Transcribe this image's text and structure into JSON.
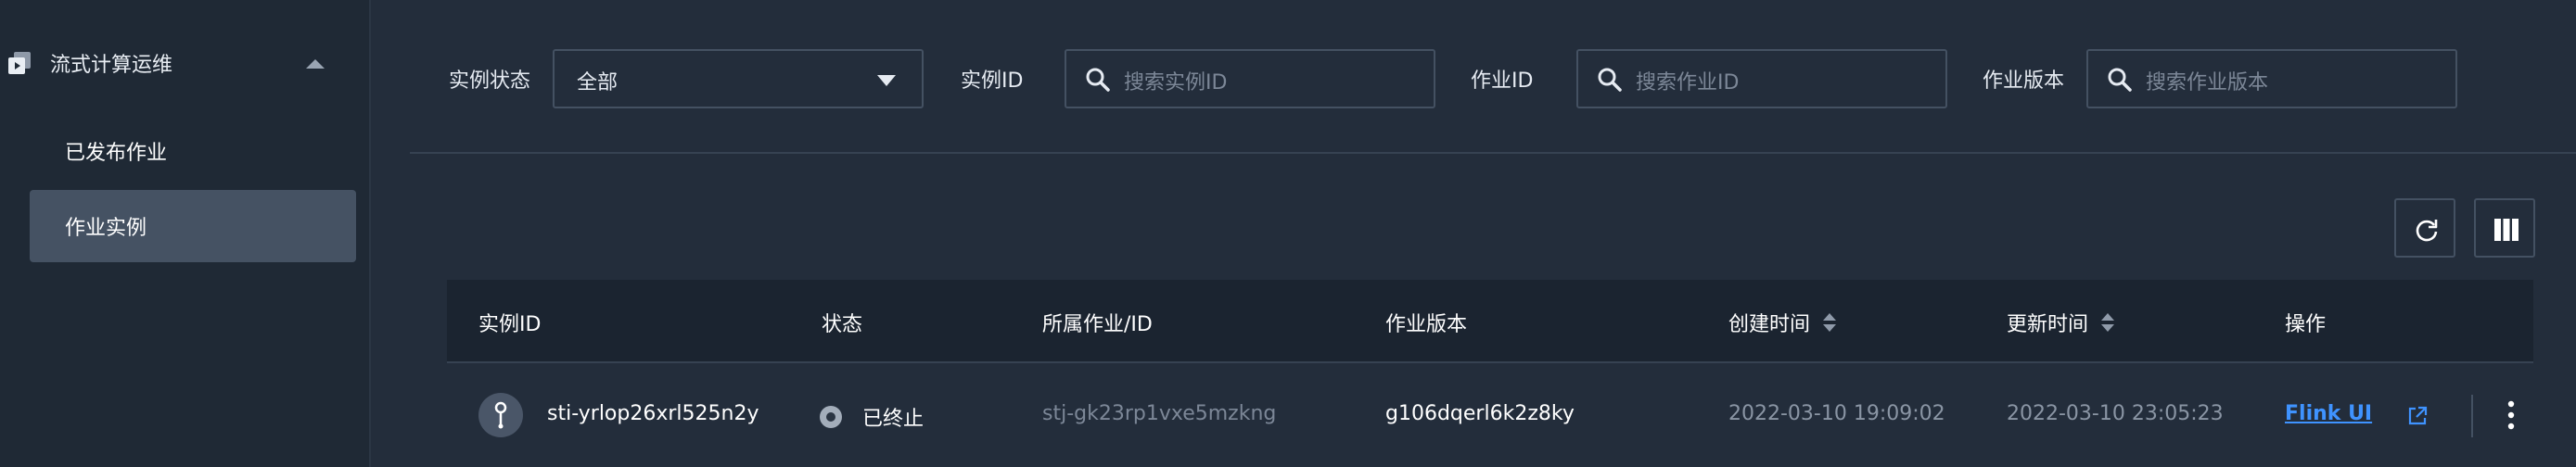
{
  "sidebar": {
    "group_label": "流式计算运维",
    "items": [
      {
        "label": "已发布作业"
      },
      {
        "label": "作业实例"
      }
    ]
  },
  "filters": {
    "status_label": "实例状态",
    "status_value": "全部",
    "instance_id_label": "实例ID",
    "instance_id_placeholder": "搜索实例ID",
    "job_id_label": "作业ID",
    "job_id_placeholder": "搜索作业ID",
    "job_version_label": "作业版本",
    "job_version_placeholder": "搜索作业版本"
  },
  "table": {
    "headers": [
      "实例ID",
      "状态",
      "所属作业/ID",
      "作业版本",
      "创建时间",
      "更新时间",
      "操作"
    ],
    "rows": [
      {
        "instance_id": "sti-yrlop26xrl525n2y",
        "status": "已终止",
        "job_id": "stj-gk23rp1vxe5mzkng",
        "job_version": "g106dqerl6k2z8ky",
        "created": "2022-03-10 19:09:02",
        "updated": "2022-03-10 23:05:23",
        "action": "Flink UI"
      }
    ]
  },
  "icons": {
    "refresh": "refresh-icon",
    "columns": "columns-icon",
    "search": "search-icon",
    "more": "more-vertical-icon",
    "external": "external-link-icon"
  },
  "colors": {
    "background": "#232d3b",
    "sidebar": "#1f2935",
    "active_item": "#455263",
    "table_header": "#1b2430",
    "link": "#3f93ff"
  }
}
